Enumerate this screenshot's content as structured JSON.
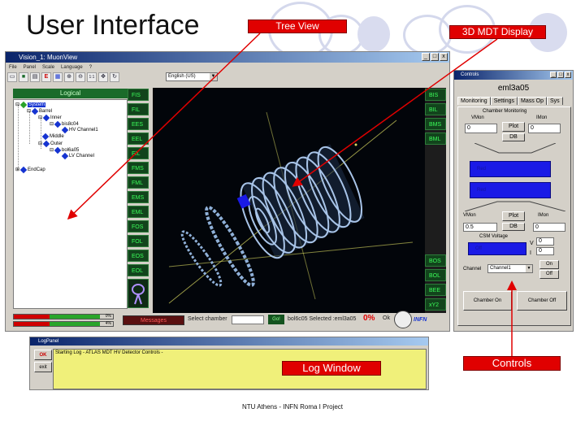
{
  "slide": {
    "title": "User Interface",
    "labels": {
      "tree_view": "Tree View",
      "display_3d": "3D MDT Display",
      "log_window": "Log Window",
      "controls": "Controls"
    },
    "footer": "NTU Athens - INFN Roma I Project"
  },
  "main_window": {
    "title": "Vision_1: MuonView",
    "window_buttons": [
      "_",
      "□",
      "x"
    ],
    "menu": [
      "File",
      "Panel",
      "Scale",
      "Language",
      "?"
    ],
    "toolbar_icons": [
      "open-icon",
      "save-icon",
      "print-icon",
      "e-icon",
      "grid-icon",
      "zoom-in-icon",
      "zoom-out-icon",
      "1:1-icon",
      "pan-icon",
      "rotate-icon"
    ],
    "toolbar_one_to_one": "1:1",
    "language_selected": "English (US)",
    "logical_header": "Logical",
    "tree": {
      "nodes": [
        "System",
        "Barrel",
        "Inner",
        "bis8c04",
        "HV Channel1",
        "Middle",
        "Outer",
        "bol6a05",
        "LV Channel",
        "EndCap"
      ]
    },
    "left_buttons": [
      "FIS",
      "FIL",
      "EES",
      "EEL",
      "EIL",
      "FMS",
      "FML",
      "EMS",
      "EML",
      "FOS",
      "FOL",
      "EOS",
      "EOL"
    ],
    "right_buttons_top": [
      "BIS",
      "BIL",
      "BMS",
      "BML"
    ],
    "right_buttons_bottom": [
      "BOS",
      "BOL",
      "BEE",
      "xY2"
    ],
    "status": {
      "progress": [
        {
          "label": "0%",
          "value": 0.42
        },
        {
          "label": "4%",
          "value": 0.42
        }
      ],
      "messages": "Messages",
      "select_chamber_label": "Select chamber",
      "go_label": "Go!",
      "selection_text": "bol6c05  Selected :eml3a05",
      "percent": "0%",
      "ok": "Ok",
      "logo": "INFN"
    }
  },
  "controls_panel": {
    "title": "Controls",
    "chamber": "eml3a05",
    "tabs": [
      "Monitoring",
      "Settings",
      "Mass Op",
      "Sys"
    ],
    "chamber_monitoring_label": "Chamber Monitoring",
    "vmon_label": "VMon",
    "imon_label": "IMon",
    "vmon_value": "0",
    "imon_value": "0",
    "plot_label": "Plot",
    "db_label": "DB",
    "blue_box_1": "Red",
    "blue_box_2": "Red",
    "vmon2_label": "VMon",
    "imon2_label": "IMon",
    "plot2_label": "Plot",
    "vmon2_value": "0.5",
    "imon2_value": "0",
    "db2_label": "DB",
    "csm_voltage_label": "CSM Voltage",
    "v_label": "V",
    "i_label": "I",
    "v_value": "0",
    "i_value": "0",
    "csm_box": "Off",
    "on_label": "On",
    "off_label": "Off",
    "channel_label": "Channel",
    "channel_value": "Channel1",
    "chamber_on": "Chamber On",
    "chamber_off": "Chamber Off"
  },
  "log_panel": {
    "title": "LogPanel",
    "ok_button": "OK",
    "exit_button": "exit",
    "line1": "Starting Log - ATLAS MDT HV Detector Controls -"
  },
  "colors": {
    "annotation_red": "#e00000",
    "button_green": "#3cff5a",
    "log_yellow": "#f0f07a",
    "panel_gray": "#d4d0c8"
  }
}
